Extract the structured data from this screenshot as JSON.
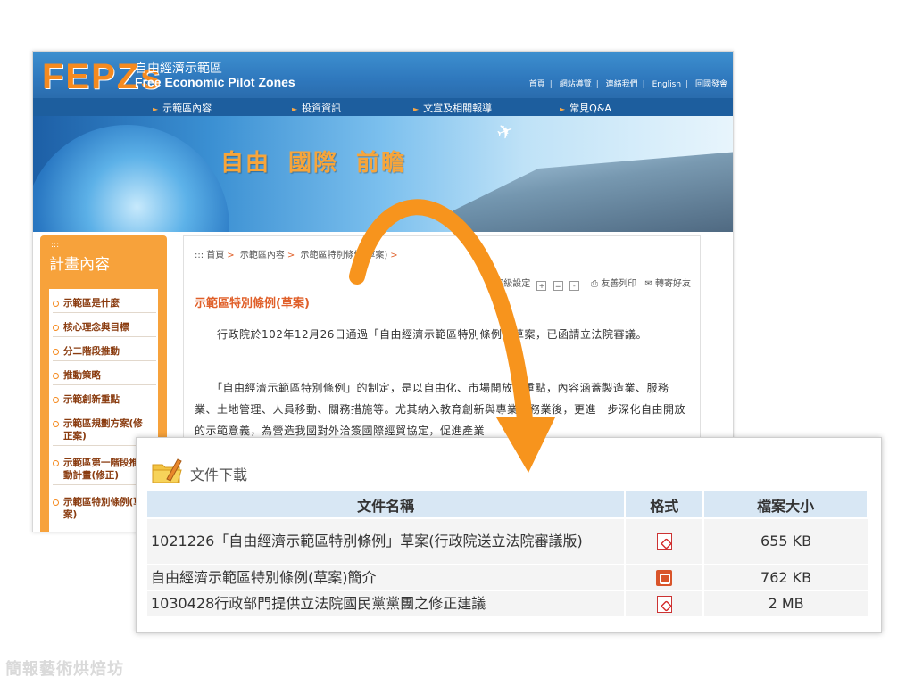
{
  "site": {
    "logo_mark": "FEPZs",
    "logo_zh": "自由經濟示範區",
    "logo_en": "Free Economic Pilot Zones",
    "utility_links": [
      "首頁",
      "網站導覽",
      "連絡我們",
      "English",
      "回國發會"
    ],
    "nav": [
      "示範區內容",
      "投資資訊",
      "文宣及相關報導",
      "常見Q&A"
    ],
    "banner_slogan": [
      "自由",
      "國際",
      "前瞻"
    ],
    "side_panel": {
      "dots": ":::",
      "title": "計畫內容",
      "items": [
        "示範區是什麼",
        "核心理念與目標",
        "分二階段推動",
        "推動策略",
        "示範創新重點",
        "示範區規劃方案(修正案)",
        "示範區第一階段推動計畫(修正)",
        "示範區特別條例(草案)"
      ]
    },
    "breadcrumb": {
      "dots": ":::",
      "items": [
        "首頁",
        "示範區內容",
        "示範區特別條例(草案)"
      ]
    },
    "tools": {
      "font_size_label": "字級設定",
      "print_label": "友善列印",
      "forward_label": "轉寄好友"
    },
    "article_title": "示範區特別條例(草案)",
    "paragraphs": [
      "　　行政院於102年12月26日通過「自由經濟示範區特別條例」草案，已函請立法院審議。",
      "　　「自由經濟示範區特別條例」的制定，是以自由化、市場開放為重點，內容涵蓋製造業、服務業、土地管理、人員移動、關務措施等。尤其納入教育創新與專業服務業後，更進一步深化自由開放的示範意義，為營造我國對外洽簽國際經貿協定，促進產業"
    ]
  },
  "card": {
    "title": "文件下載",
    "headers": {
      "name": "文件名稱",
      "format": "格式",
      "size": "檔案大小"
    },
    "rows": [
      {
        "name": "1021226「自由經濟示範區特別條例」草案(行政院送立法院審議版)",
        "format": "pdf-icon",
        "size": "655 KB"
      },
      {
        "name": "自由經濟示範區特別條例(草案)簡介",
        "format": "ppt-icon",
        "size": "762 KB"
      },
      {
        "name": "1030428行政部門提供立法院國民黨黨團之修正建議",
        "format": "pdf-icon",
        "size": "2 MB"
      }
    ]
  },
  "colors": {
    "accent_orange": "#f7941d",
    "header_blue": "#2f78bd",
    "table_header": "#d8e7f4"
  },
  "watermark": "簡報藝術烘焙坊"
}
